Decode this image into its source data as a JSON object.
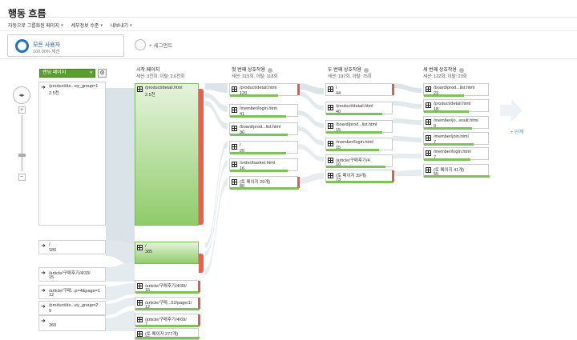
{
  "header": {
    "title": "행동 흐름"
  },
  "menu": [
    {
      "label": "자동으로 그룹화된 페이지"
    },
    {
      "label": "세부정보 수준"
    },
    {
      "label": "내보내기"
    }
  ],
  "segments": {
    "active": {
      "name": "모든 사용자",
      "pct": "100.00% 세션"
    },
    "add_label": "+ 세그먼트"
  },
  "dimension": {
    "selected": "랜딩 페이지"
  },
  "columns": {
    "start": {
      "title": "시작 페이지",
      "sub": "세션: 3천회, 이탈: 2.6천회"
    },
    "first": {
      "title": "첫 번째 상호작용",
      "sub": "세션: 315회, 이탈: 118회"
    },
    "second": {
      "title": "두 번째 상호작용",
      "sub": "세션: 197회, 이탈: 75회"
    },
    "third": {
      "title": "세 번째 상호작용",
      "sub": "세션: 122회, 이탈: 23회"
    }
  },
  "sources": [
    {
      "label": "/product/de...ey_group=1",
      "value": "2.5천"
    },
    {
      "label": "/",
      "value": "186"
    },
    {
      "label": "/article/구매후기/4/33/",
      "value": "15"
    },
    {
      "label": "/article/구매...p=4&page=1",
      "value": "12"
    },
    {
      "label": "/product/de...ey_group=2",
      "value": "9"
    },
    {
      "label": "",
      "value": "260"
    }
  ],
  "start_nodes": [
    {
      "label": "/product/detail.html",
      "value": "2.5천"
    },
    {
      "label": "/",
      "value": "385"
    },
    {
      "label": "/article/구매후기/4/30/",
      "value": "15"
    },
    {
      "label": "/article/구매...52/page/1/",
      "value": "12"
    },
    {
      "label": "/article/구매후기/4/69/",
      "value": "7"
    },
    {
      "label": "(토 페이지 277개)",
      "value": "60"
    }
  ],
  "first_nodes": [
    {
      "label": "/product/detail.html",
      "value": "120"
    },
    {
      "label": "/member/login.html",
      "value": "41"
    },
    {
      "label": "/board/prod...list.html",
      "value": "36"
    },
    {
      "label": "/",
      "value": "20"
    },
    {
      "label": "/order/basket.html",
      "value": "16"
    },
    {
      "label": "(토 페이지 29개)",
      "value": "80"
    }
  ],
  "second_nodes": [
    {
      "label": "/",
      "value": "44"
    },
    {
      "label": "/product/detail.html",
      "value": "40"
    },
    {
      "label": "/board/prod...list.html",
      "value": "15"
    },
    {
      "label": "/member/login.html",
      "value": "15"
    },
    {
      "label": "/article/구매후기/4",
      "value": "10"
    },
    {
      "label": "(토 페이지 39개)",
      "value": "73"
    }
  ],
  "third_nodes": [
    {
      "label": "/board/prod...list.html",
      "value": "23"
    },
    {
      "label": "/product/detail.html",
      "value": "18"
    },
    {
      "label": "/member/jo...esult.html",
      "value": "9"
    },
    {
      "label": "/member/join.html",
      "value": "7"
    },
    {
      "label": "/member/login.html",
      "value": "7"
    },
    {
      "label": "(토 페이지 41개)",
      "value": "55"
    }
  ],
  "next_step_label": "+ 단계"
}
